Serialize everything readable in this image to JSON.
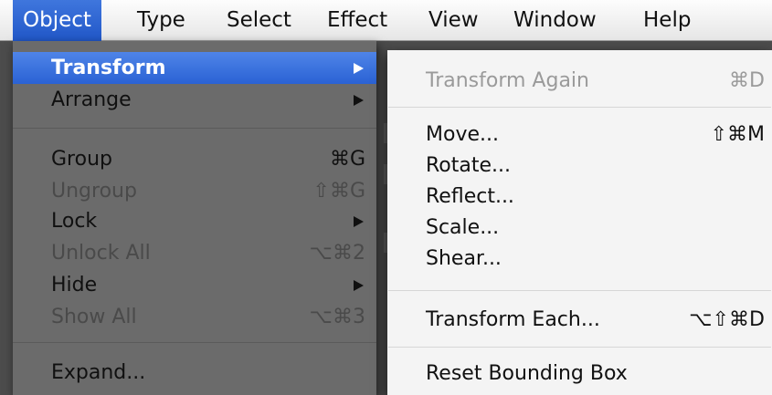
{
  "menubar": {
    "items": [
      {
        "label": "Object",
        "active": true
      },
      {
        "label": "Type"
      },
      {
        "label": "Select"
      },
      {
        "label": "Effect"
      },
      {
        "label": "View"
      },
      {
        "label": "Window"
      },
      {
        "label": "Help"
      }
    ]
  },
  "object_menu": {
    "items": [
      {
        "label": "Transform",
        "submenu": true,
        "highlighted": true
      },
      {
        "label": "Arrange",
        "submenu": true
      },
      {
        "label": "Group",
        "shortcut": "⌘G"
      },
      {
        "label": "Ungroup",
        "shortcut": "⇧⌘G",
        "disabled": true
      },
      {
        "label": "Lock",
        "submenu": true
      },
      {
        "label": "Unlock All",
        "shortcut": "⌥⌘2",
        "disabled": true
      },
      {
        "label": "Hide",
        "submenu": true
      },
      {
        "label": "Show All",
        "shortcut": "⌥⌘3",
        "disabled": true
      },
      {
        "label": "Expand..."
      }
    ]
  },
  "transform_submenu": {
    "items": [
      {
        "label": "Transform Again",
        "shortcut": "⌘D",
        "disabled": true
      },
      {
        "label": "Move...",
        "shortcut": "⇧⌘M"
      },
      {
        "label": "Rotate..."
      },
      {
        "label": "Reflect..."
      },
      {
        "label": "Scale..."
      },
      {
        "label": "Shear..."
      },
      {
        "label": "Transform Each...",
        "shortcut": "⌥⇧⌘D"
      },
      {
        "label": "Reset Bounding Box"
      }
    ]
  }
}
